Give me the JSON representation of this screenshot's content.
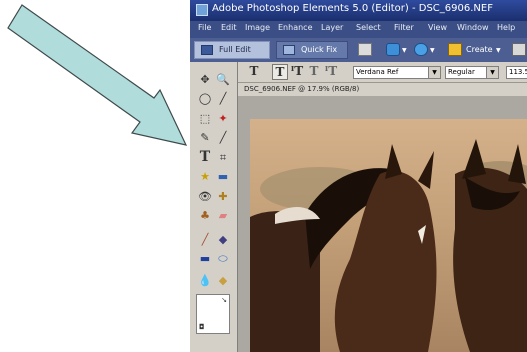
{
  "window": {
    "title": "Adobe Photoshop Elements 5.0 (Editor) - DSC_6906.NEF"
  },
  "menu": {
    "items": [
      "File",
      "Edit",
      "Image",
      "Enhance",
      "Layer",
      "Select",
      "Filter",
      "View",
      "Window",
      "Help"
    ]
  },
  "modebar": {
    "full_edit": "Full Edit",
    "quick_fix": "Quick Fix",
    "create": "Create"
  },
  "options": {
    "font_family": "Verdana Ref",
    "font_style": "Regular",
    "font_size": "113.5"
  },
  "document": {
    "tab_title": "DSC_6906.NEF @ 17.9% (RGB/8)"
  },
  "tools": [
    "move-tool",
    "zoom-tool",
    "lasso-tool",
    "eyedropper-tool",
    "marquee-tool",
    "magic-wand-tool",
    "quick-selection-tool",
    "brush-tool",
    "type-tool",
    "crop-tool",
    "cookie-cutter-tool",
    "straighten-tool",
    "red-eye-tool",
    "healing-brush-tool",
    "clone-stamp-tool",
    "eraser-tool",
    "pencil-tool",
    "paint-bucket-tool",
    "gradient-tool",
    "shape-tool",
    "blur-tool",
    "sponge-tool"
  ],
  "colors": {
    "arrow_fill": "#b0dcdc",
    "titlebar": "#1b2f6e",
    "panel": "#d4d0c8"
  }
}
